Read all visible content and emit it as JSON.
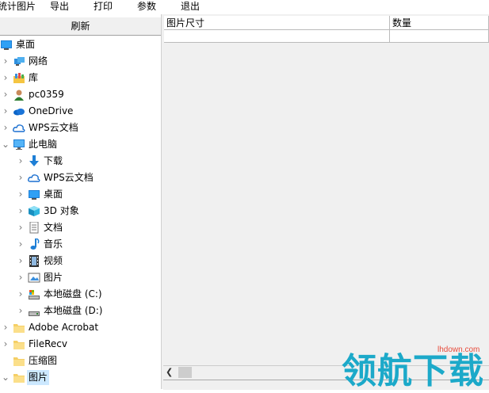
{
  "menu": {
    "items": [
      "统计图片",
      "导出",
      "打印",
      "参数",
      "退出"
    ]
  },
  "left": {
    "refresh_label": "刷新",
    "tree": [
      {
        "label": "桌面",
        "icon": "desktop-icon",
        "level": 0,
        "expander": "none"
      },
      {
        "label": "网络",
        "icon": "network-icon",
        "level": 1,
        "expander": "collapsed"
      },
      {
        "label": "库",
        "icon": "library-icon",
        "level": 1,
        "expander": "collapsed"
      },
      {
        "label": "pc0359",
        "icon": "user-icon",
        "level": 1,
        "expander": "collapsed"
      },
      {
        "label": "OneDrive",
        "icon": "onedrive-cloud-icon",
        "level": 1,
        "expander": "collapsed"
      },
      {
        "label": "WPS云文档",
        "icon": "wps-cloud-icon",
        "level": 1,
        "expander": "collapsed"
      },
      {
        "label": "此电脑",
        "icon": "computer-icon",
        "level": 1,
        "expander": "expanded"
      },
      {
        "label": "下载",
        "icon": "download-icon",
        "level": 2,
        "expander": "collapsed"
      },
      {
        "label": "WPS云文档",
        "icon": "wps-cloud-icon",
        "level": 2,
        "expander": "collapsed"
      },
      {
        "label": "桌面",
        "icon": "desktop-icon",
        "level": 2,
        "expander": "collapsed"
      },
      {
        "label": "3D 对象",
        "icon": "3d-objects-icon",
        "level": 2,
        "expander": "collapsed"
      },
      {
        "label": "文档",
        "icon": "document-icon",
        "level": 2,
        "expander": "collapsed"
      },
      {
        "label": "音乐",
        "icon": "music-icon",
        "level": 2,
        "expander": "collapsed"
      },
      {
        "label": "视频",
        "icon": "video-icon",
        "level": 2,
        "expander": "collapsed"
      },
      {
        "label": "图片",
        "icon": "pictures-icon",
        "level": 2,
        "expander": "collapsed"
      },
      {
        "label": "本地磁盘 (C:)",
        "icon": "drive-c-icon",
        "level": 2,
        "expander": "collapsed"
      },
      {
        "label": "本地磁盘 (D:)",
        "icon": "drive-icon",
        "level": 2,
        "expander": "collapsed"
      },
      {
        "label": "Adobe Acrobat",
        "icon": "folder-icon",
        "level": 1,
        "expander": "collapsed"
      },
      {
        "label": "FileRecv",
        "icon": "folder-icon",
        "level": 1,
        "expander": "collapsed"
      },
      {
        "label": "压缩图",
        "icon": "folder-icon",
        "level": 1,
        "expander": "none"
      },
      {
        "label": "图片",
        "icon": "folder-icon",
        "level": 1,
        "expander": "expanded",
        "selected": true
      }
    ]
  },
  "table": {
    "columns": [
      "图片尺寸",
      "数量"
    ]
  },
  "watermark": {
    "text": "领航下载",
    "url": "lhdown.com"
  }
}
